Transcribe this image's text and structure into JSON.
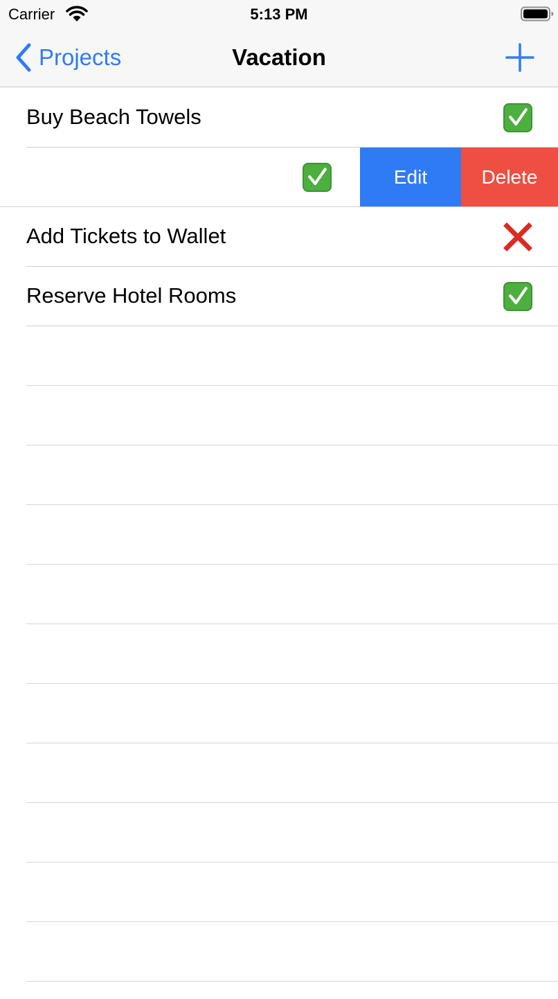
{
  "status_bar": {
    "carrier": "Carrier",
    "time": "5:13 PM"
  },
  "nav": {
    "back_label": "Projects",
    "title": "Vacation",
    "add_icon": "plus-icon"
  },
  "tasks": [
    {
      "label": "Buy Beach Towels",
      "status": "done",
      "icon": "check-icon"
    },
    {
      "label": "",
      "status": "done",
      "icon": "check-icon",
      "swiped": true
    },
    {
      "label": "Add Tickets to Wallet",
      "status": "not-done",
      "icon": "cross-icon"
    },
    {
      "label": "Reserve Hotel Rooms",
      "status": "done",
      "icon": "check-icon"
    }
  ],
  "swipe_actions": {
    "edit_label": "Edit",
    "delete_label": "Delete"
  },
  "colors": {
    "accent": "#2f7bf5",
    "delete": "#ef4e42",
    "check": "#4caf3f",
    "cross": "#d92b24"
  }
}
